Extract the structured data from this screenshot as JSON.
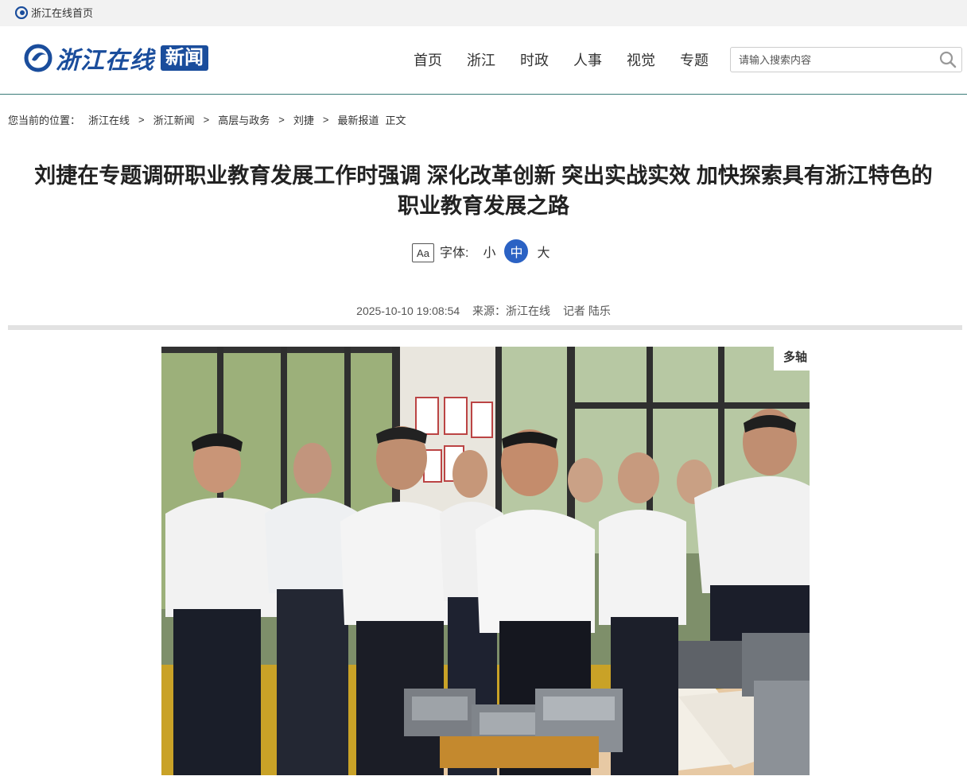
{
  "topbar": {
    "home_label": "浙江在线首页"
  },
  "header": {
    "brand": "浙江在线",
    "section_tag": "新闻",
    "nav": [
      "首页",
      "浙江",
      "时政",
      "人事",
      "视觉",
      "专题"
    ],
    "search_placeholder": "请输入搜索内容"
  },
  "breadcrumb": {
    "label": "您当前的位置：",
    "items": [
      "浙江在线",
      "浙江新闻",
      "高层与政务",
      "刘捷",
      "最新报道"
    ],
    "current": "正文"
  },
  "article": {
    "title_line1": "刘捷在专题调研职业教育发展工作时强调 深化改革创新 突出实战实效 加快探索具有浙江特色的",
    "title_line2": "职业教育发展之路",
    "font_label": "字体:",
    "font_icon_text": "Aa",
    "font_options": [
      "小",
      "中",
      "大"
    ],
    "font_selected": "中",
    "datetime": "2025-10-10 19:08:54",
    "source_label": "来源：",
    "source": "浙江在线",
    "reporter": "记者 陆乐",
    "photo_sign_text": "多轴"
  },
  "colors": {
    "brand_blue": "#1a4d9c",
    "accent_blue": "#2b62c4",
    "header_line": "#3a7c78"
  }
}
